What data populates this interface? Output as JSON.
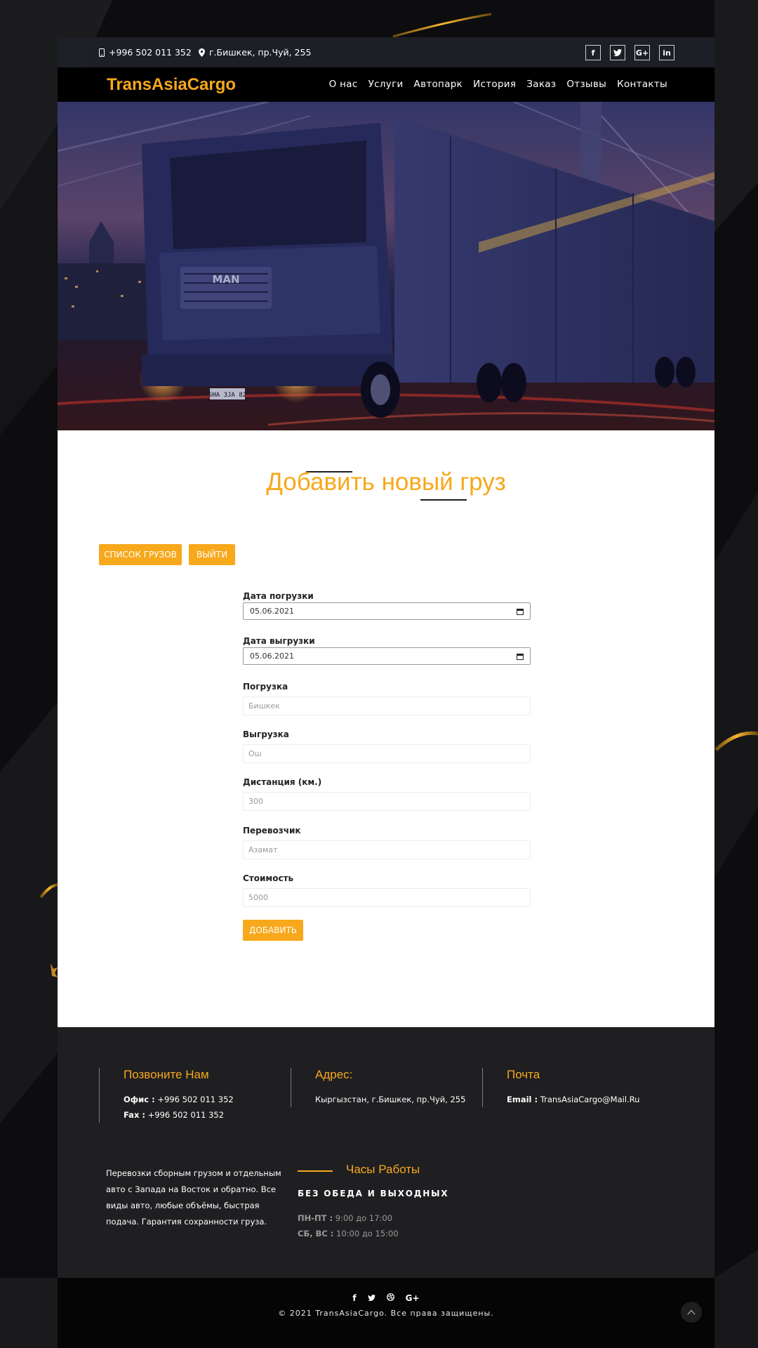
{
  "topbar": {
    "phone": "+996 502 011 352",
    "address": "г.Бишкек, пр.Чуй, 255",
    "socials": [
      "f",
      "t",
      "G+",
      "in"
    ]
  },
  "nav": {
    "brand": "TransAsiaCargo",
    "items": [
      "О нас",
      "Услуги",
      "Автопарк",
      "История",
      "Заказ",
      "Отзывы",
      "Контакты"
    ]
  },
  "hero": {
    "truck_brand": "MAN",
    "plate": "SHA 3JA 82"
  },
  "main": {
    "title": "Добавить новый груз",
    "buttons": {
      "list": "СПИСОК ГРУЗОВ",
      "exit": "ВЫЙТИ",
      "add": "ДОБАВИТЬ"
    },
    "fields": {
      "load_date": {
        "label": "Дата погрузки",
        "value": "05.06.2021"
      },
      "unload_date": {
        "label": "Дата выгрузки",
        "value": "05.06.2021"
      },
      "loading": {
        "label": "Погрузка",
        "placeholder": "Бишкек"
      },
      "unloading": {
        "label": "Выгрузка",
        "placeholder": "Ош"
      },
      "distance": {
        "label": "Дистанция (км.)",
        "placeholder": "300"
      },
      "carrier": {
        "label": "Перевозчик",
        "placeholder": "Азамат"
      },
      "cost": {
        "label": "Стоимость",
        "placeholder": "5000"
      }
    }
  },
  "footer": {
    "call": {
      "title": "Позвоните Нам",
      "office_label": "Офис :",
      "office": "+996 502 011 352",
      "fax_label": "Fax :",
      "fax": "+996 502 011 352"
    },
    "address": {
      "title": "Адрес:",
      "text": "Кыргызстан, г.Бишкек, пр.Чуй, 255"
    },
    "mail": {
      "title": "Почта",
      "email_label": "Email :",
      "email": "TransAsiaCargo@Mail.Ru"
    },
    "about": "Перевозки сборным грузом и отдельным авто с Запада на Восток и обратно. Все виды авто, любые объёмы, быстрая подача. Гарантия сохранности груза.",
    "hours": {
      "title": "Часы Работы",
      "subtitle": "БЕЗ ОБЕДА И ВЫХОДНЫХ",
      "weekdays_label": "ПН-ПТ :",
      "weekdays": "9:00 до 17:00",
      "weekend_label": "СБ, ВС :",
      "weekend": "10:00 до 15:00"
    }
  },
  "bottom": {
    "copyright": "© 2021 TransAsiaCargo. Все права защищены.",
    "scroll_icon": "chevron-up-icon"
  },
  "colors": {
    "accent": "#f7a81b",
    "dark": "#1f1f22"
  }
}
